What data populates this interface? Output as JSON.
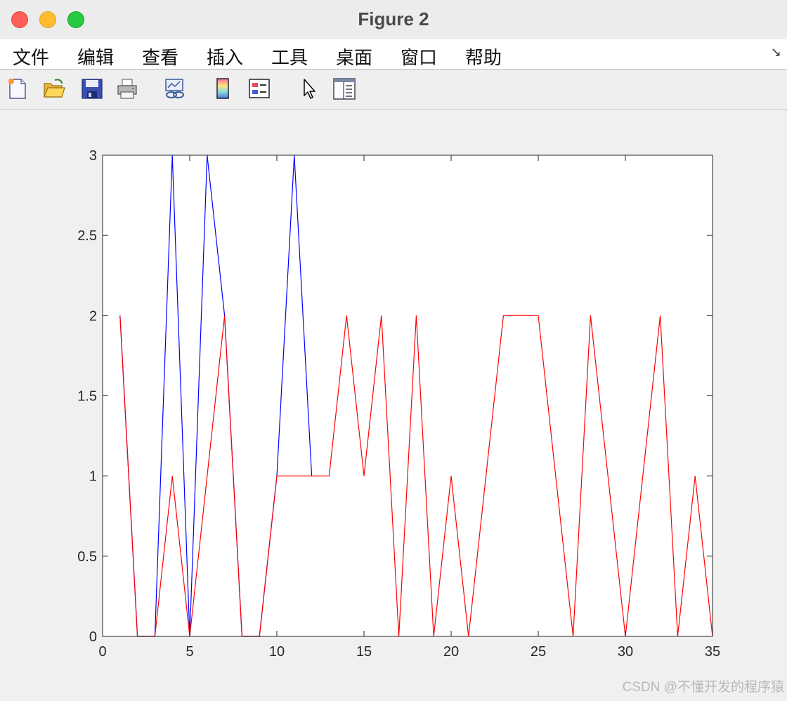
{
  "window": {
    "title": "Figure 2"
  },
  "menu": {
    "items": [
      "文件",
      "编辑",
      "查看",
      "插入",
      "工具",
      "桌面",
      "窗口",
      "帮助"
    ],
    "corner_icon": "↘"
  },
  "toolbar": {
    "buttons": [
      {
        "icon": "new-figure-icon"
      },
      {
        "icon": "open-file-icon"
      },
      {
        "icon": "save-icon"
      },
      {
        "icon": "print-icon"
      },
      {
        "icon": "link-plot-icon"
      },
      {
        "icon": "insert-colorbar-icon"
      },
      {
        "icon": "insert-legend-icon"
      },
      {
        "icon": "pointer-icon"
      },
      {
        "icon": "property-inspector-icon"
      }
    ]
  },
  "watermark": "CSDN @不懂开发的程序猿",
  "chart_data": {
    "type": "line",
    "title": "",
    "xlabel": "",
    "ylabel": "",
    "xlim": [
      0,
      35
    ],
    "ylim": [
      0,
      3
    ],
    "xticks": [
      0,
      5,
      10,
      15,
      20,
      25,
      30,
      35
    ],
    "yticks": [
      0,
      0.5,
      1,
      1.5,
      2,
      2.5,
      3
    ],
    "ytick_labels": [
      "0",
      "0.5",
      "1",
      "1.5",
      "2",
      "2.5",
      "3"
    ],
    "grid": false,
    "box": true,
    "series": [
      {
        "color": "#0000ff",
        "x": [
          1,
          2,
          3,
          4,
          5,
          6,
          7,
          8,
          9,
          10,
          11,
          12
        ],
        "y": [
          2,
          0,
          0,
          3,
          0,
          3,
          2,
          0,
          0,
          1,
          3,
          1
        ]
      },
      {
        "color": "#ff0000",
        "x": [
          1,
          2,
          3,
          4,
          5,
          6,
          7,
          8,
          9,
          10,
          11,
          12,
          13,
          14,
          15,
          16,
          17,
          18,
          19,
          20,
          21,
          22,
          23,
          24,
          25,
          26,
          27,
          28,
          29,
          30,
          31,
          32,
          33,
          34,
          35
        ],
        "y": [
          2,
          0,
          0,
          1,
          0,
          1,
          2,
          0,
          0,
          1,
          1,
          1,
          1,
          2,
          1,
          2,
          0,
          2,
          0,
          1,
          0,
          1,
          2,
          2,
          2,
          1,
          0,
          2,
          1,
          0,
          1,
          2,
          0,
          1,
          0
        ]
      }
    ]
  }
}
